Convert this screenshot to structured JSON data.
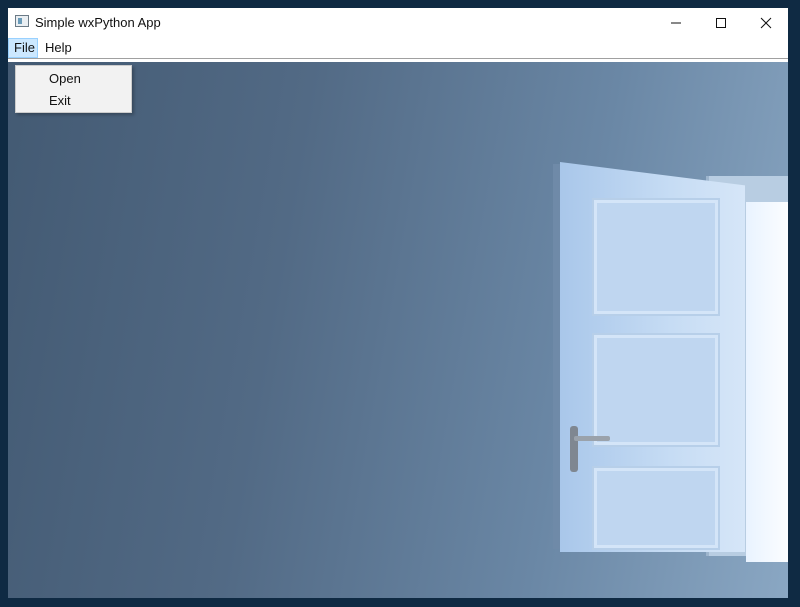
{
  "window": {
    "title": "Simple wxPython App",
    "icon": "app-window-icon"
  },
  "controls": {
    "minimize": "minimize-icon",
    "maximize": "maximize-icon",
    "close": "close-icon"
  },
  "menubar": {
    "items": [
      {
        "label": "File",
        "active": true
      },
      {
        "label": "Help",
        "active": false
      }
    ]
  },
  "file_menu": {
    "items": [
      {
        "label": "Open"
      },
      {
        "label": "Exit"
      }
    ]
  },
  "colors": {
    "menu_highlight": "#cce8ff",
    "desktop_bg": "#0f2a43"
  }
}
